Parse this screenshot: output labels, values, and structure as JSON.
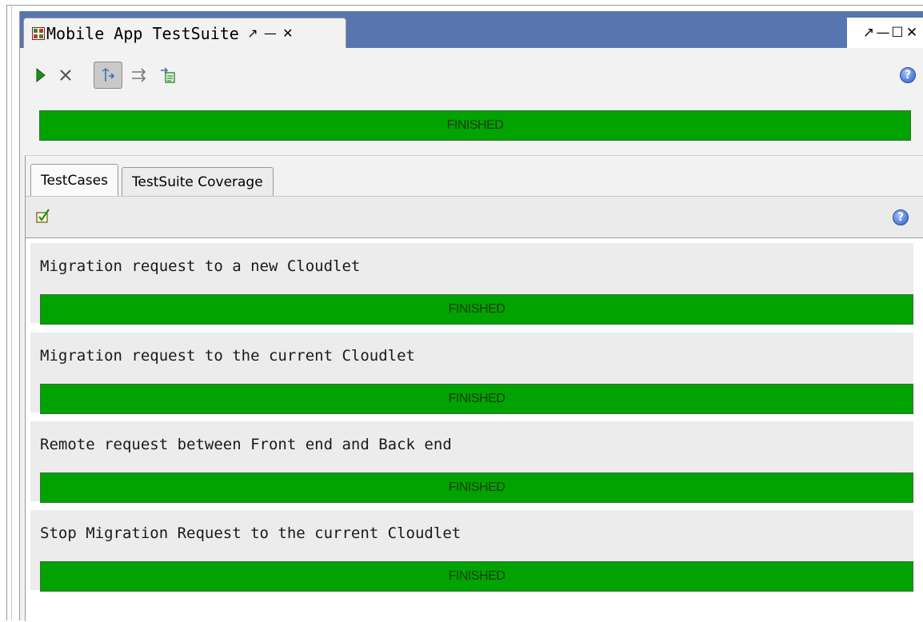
{
  "view": {
    "title": "Mobile App TestSuite",
    "tab_controls": [
      "↗",
      "—",
      "✕"
    ],
    "window_controls": [
      "↗",
      "—",
      "☐",
      "✕"
    ]
  },
  "toolbar": {
    "icons": [
      "run-icon",
      "stop-icon",
      "toggle-layout-icon",
      "next-icon",
      "export-icon"
    ],
    "help_icon": "help-icon"
  },
  "suite_progress": {
    "status": "FINISHED",
    "progress": 1.0,
    "color": "#00a300"
  },
  "tabs": [
    {
      "label": "TestCases",
      "active": true
    },
    {
      "label": "TestSuite Coverage",
      "active": false
    }
  ],
  "testcases": [
    {
      "name": "Migration request to a new Cloudlet",
      "status": "FINISHED",
      "progress": 1.0
    },
    {
      "name": "Migration request to the current Cloudlet",
      "status": "FINISHED",
      "progress": 1.0
    },
    {
      "name": "Remote request between Front end and Back end",
      "status": "FINISHED",
      "progress": 1.0
    },
    {
      "name": "Stop Migration Request to the current Cloudlet",
      "status": "FINISHED",
      "progress": 1.0
    }
  ],
  "colors": {
    "accent_bar": "#5776b0",
    "finished": "#00a300"
  }
}
